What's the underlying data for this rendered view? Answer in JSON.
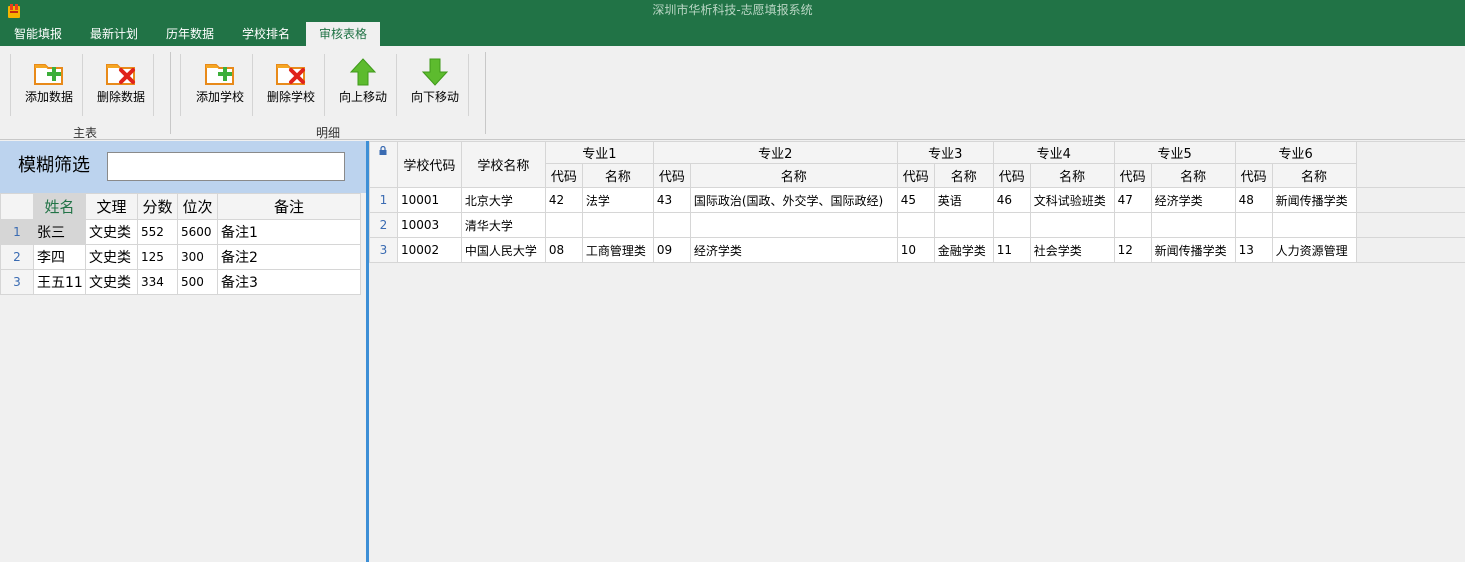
{
  "window": {
    "title": "深圳市华析科技-志愿填报系统",
    "icon": "app-logo-icon",
    "colors": {
      "accent": "#217346",
      "selection": "#d6d6d6",
      "splitter": "#3d8fd6",
      "filter_bar": "#bcd3ee"
    }
  },
  "tabs": [
    {
      "label": "智能填报",
      "active": false
    },
    {
      "label": "最新计划",
      "active": false
    },
    {
      "label": "历年数据",
      "active": false
    },
    {
      "label": "学校排名",
      "active": false
    },
    {
      "label": "审核表格",
      "active": true
    }
  ],
  "ribbon": {
    "groups": [
      {
        "label": "主表",
        "buttons": [
          {
            "label": "添加数据",
            "icon": "add-folder-icon"
          },
          {
            "label": "删除数据",
            "icon": "delete-folder-icon"
          }
        ]
      },
      {
        "label": "明细",
        "buttons": [
          {
            "label": "添加学校",
            "icon": "add-folder-icon"
          },
          {
            "label": "删除学校",
            "icon": "delete-folder-icon"
          },
          {
            "label": "向上移动",
            "icon": "arrow-up-icon"
          },
          {
            "label": "向下移动",
            "icon": "arrow-down-icon"
          }
        ]
      }
    ]
  },
  "filter": {
    "label": "模糊筛选",
    "value": ""
  },
  "student_table": {
    "columns": [
      "姓名",
      "文理",
      "分数",
      "位次",
      "备注"
    ],
    "rows": [
      {
        "num": "1",
        "name": "张三",
        "track": "文史类",
        "score": "552",
        "rank": "5600",
        "note": "备注1"
      },
      {
        "num": "2",
        "name": "李四",
        "track": "文史类",
        "score": "125",
        "rank": "300",
        "note": "备注2"
      },
      {
        "num": "3",
        "name": "王五11",
        "track": "文史类",
        "score": "334",
        "rank": "500",
        "note": "备注3"
      }
    ]
  },
  "school_table": {
    "col_school_code": "学校代码",
    "col_school_name": "学校名称",
    "majors": [
      "专业1",
      "专业2",
      "专业3",
      "专业4",
      "专业5",
      "专业6"
    ],
    "sub_code": "代码",
    "sub_name": "名称",
    "rows": [
      {
        "num": "1",
        "code": "10001",
        "name": "北京大学",
        "m": [
          [
            "42",
            "法学"
          ],
          [
            "43",
            "国际政治(国政、外交学、国际政经)"
          ],
          [
            "45",
            "英语"
          ],
          [
            "46",
            "文科试验班类"
          ],
          [
            "47",
            "经济学类"
          ],
          [
            "48",
            "新闻传播学类"
          ]
        ]
      },
      {
        "num": "2",
        "code": "10003",
        "name": "清华大学",
        "m": [
          [
            "",
            ""
          ],
          [
            "",
            ""
          ],
          [
            "",
            ""
          ],
          [
            "",
            ""
          ],
          [
            "",
            ""
          ],
          [
            "",
            ""
          ]
        ]
      },
      {
        "num": "3",
        "code": "10002",
        "name": "中国人民大学",
        "m": [
          [
            "08",
            "工商管理类"
          ],
          [
            "09",
            "经济学类"
          ],
          [
            "10",
            "金融学类"
          ],
          [
            "11",
            "社会学类"
          ],
          [
            "12",
            "新闻传播学类"
          ],
          [
            "13",
            "人力资源管理"
          ]
        ]
      }
    ]
  }
}
